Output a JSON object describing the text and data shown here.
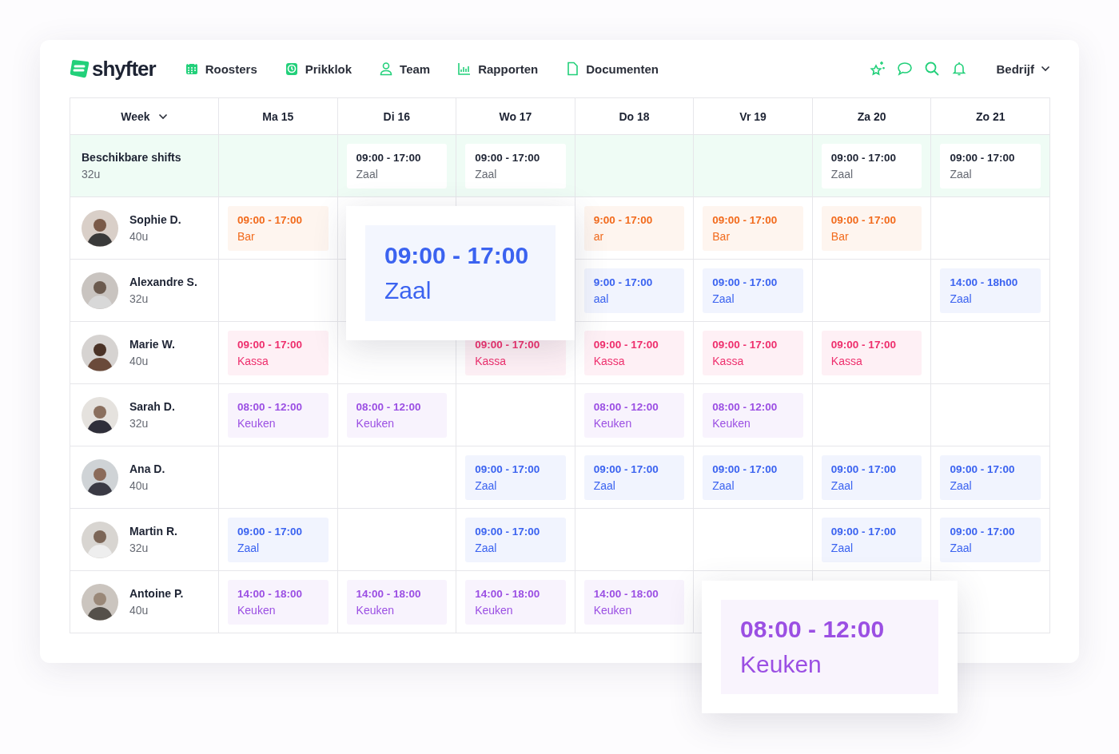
{
  "nav": {
    "logo": "shyfter",
    "items": [
      {
        "label": "Roosters"
      },
      {
        "label": "Prikklok"
      },
      {
        "label": "Team"
      },
      {
        "label": "Rapporten"
      },
      {
        "label": "Documenten"
      }
    ],
    "company": "Bedrijf"
  },
  "table": {
    "week_label": "Week",
    "days": [
      "Ma 15",
      "Di 16",
      "Wo 17",
      "Do 18",
      "Vr 19",
      "Za 20",
      "Zo 21"
    ],
    "available": {
      "title": "Beschikbare shifts",
      "hours": "32u",
      "shifts": [
        {
          "kind": "empty"
        },
        {
          "kind": "shift",
          "time": "09:00 - 17:00",
          "label": "Zaal"
        },
        {
          "kind": "shift",
          "time": "09:00 - 17:00",
          "label": "Zaal"
        },
        {
          "kind": "empty"
        },
        {
          "kind": "empty"
        },
        {
          "kind": "shift",
          "time": "09:00 - 17:00",
          "label": "Zaal"
        },
        {
          "kind": "shift",
          "time": "09:00 - 17:00",
          "label": "Zaal"
        }
      ]
    },
    "rows": [
      {
        "name": "Sophie D.",
        "hours": "40u",
        "shifts": [
          {
            "kind": "shift",
            "time": "09:00 - 17:00",
            "label": "Bar",
            "color": "#f26b1d"
          },
          {
            "kind": "empty"
          },
          {
            "kind": "empty"
          },
          {
            "kind": "shift",
            "time": "9:00 - 17:00",
            "label": "ar",
            "color": "#f26b1d"
          },
          {
            "kind": "shift",
            "time": "09:00 - 17:00",
            "label": "Bar",
            "color": "#f26b1d"
          },
          {
            "kind": "shift",
            "time": "09:00 - 17:00",
            "label": "Bar",
            "color": "#f26b1d"
          },
          {
            "kind": "empty"
          }
        ]
      },
      {
        "name": "Alexandre S.",
        "hours": "32u",
        "shifts": [
          {
            "kind": "empty"
          },
          {
            "kind": "empty"
          },
          {
            "kind": "empty"
          },
          {
            "kind": "shift",
            "time": "9:00 - 17:00",
            "label": "aal",
            "color": "#3b63f0"
          },
          {
            "kind": "shift",
            "time": "09:00 - 17:00",
            "label": "Zaal",
            "color": "#3b63f0"
          },
          {
            "kind": "empty"
          },
          {
            "kind": "shift",
            "time": "14:00 - 18h00",
            "label": "Zaal",
            "color": "#3b63f0"
          }
        ]
      },
      {
        "name": "Marie W.",
        "hours": "40u",
        "shifts": [
          {
            "kind": "shift",
            "time": "09:00 - 17:00",
            "label": "Kassa",
            "color": "#ee2f6d"
          },
          {
            "kind": "empty"
          },
          {
            "kind": "shift",
            "time": "09:00 - 17:00",
            "label": "Kassa",
            "color": "#ee2f6d"
          },
          {
            "kind": "shift",
            "time": "09:00 - 17:00",
            "label": "Kassa",
            "color": "#ee2f6d"
          },
          {
            "kind": "shift",
            "time": "09:00 - 17:00",
            "label": "Kassa",
            "color": "#ee2f6d"
          },
          {
            "kind": "shift",
            "time": "09:00 - 17:00",
            "label": "Kassa",
            "color": "#ee2f6d"
          },
          {
            "kind": "empty"
          }
        ]
      },
      {
        "name": "Sarah D.",
        "hours": "32u",
        "shifts": [
          {
            "kind": "shift",
            "time": "08:00 - 12:00",
            "label": "Keuken",
            "color": "#9b4fe3"
          },
          {
            "kind": "shift",
            "time": "08:00 - 12:00",
            "label": "Keuken",
            "color": "#9b4fe3"
          },
          {
            "kind": "empty"
          },
          {
            "kind": "shift",
            "time": "08:00 - 12:00",
            "label": "Keuken",
            "color": "#9b4fe3"
          },
          {
            "kind": "shift",
            "time": "08:00 - 12:00",
            "label": "Keuken",
            "color": "#9b4fe3"
          },
          {
            "kind": "empty"
          },
          {
            "kind": "empty"
          }
        ]
      },
      {
        "name": "Ana D.",
        "hours": "40u",
        "shifts": [
          {
            "kind": "empty"
          },
          {
            "kind": "empty"
          },
          {
            "kind": "shift",
            "time": "09:00 - 17:00",
            "label": "Zaal",
            "color": "#3b63f0"
          },
          {
            "kind": "shift",
            "time": "09:00 - 17:00",
            "label": "Zaal",
            "color": "#3b63f0"
          },
          {
            "kind": "shift",
            "time": "09:00 - 17:00",
            "label": "Zaal",
            "color": "#3b63f0"
          },
          {
            "kind": "shift",
            "time": "09:00 - 17:00",
            "label": "Zaal",
            "color": "#3b63f0"
          },
          {
            "kind": "shift",
            "time": "09:00 - 17:00",
            "label": "Zaal",
            "color": "#3b63f0"
          }
        ]
      },
      {
        "name": "Martin R.",
        "hours": "32u",
        "shifts": [
          {
            "kind": "shift",
            "time": "09:00 - 17:00",
            "label": "Zaal",
            "color": "#3b63f0"
          },
          {
            "kind": "empty"
          },
          {
            "kind": "shift",
            "time": "09:00 - 17:00",
            "label": "Zaal",
            "color": "#3b63f0"
          },
          {
            "kind": "empty"
          },
          {
            "kind": "empty"
          },
          {
            "kind": "shift",
            "time": "09:00 - 17:00",
            "label": "Zaal",
            "color": "#3b63f0"
          },
          {
            "kind": "shift",
            "time": "09:00 - 17:00",
            "label": "Zaal",
            "color": "#3b63f0"
          }
        ]
      },
      {
        "name": "Antoine P.",
        "hours": "40u",
        "shifts": [
          {
            "kind": "shift",
            "time": "14:00 - 18:00",
            "label": "Keuken",
            "color": "#9b4fe3"
          },
          {
            "kind": "shift",
            "time": "14:00 - 18:00",
            "label": "Keuken",
            "color": "#9b4fe3"
          },
          {
            "kind": "shift",
            "time": "14:00 - 18:00",
            "label": "Keuken",
            "color": "#9b4fe3"
          },
          {
            "kind": "shift",
            "time": "14:00 - 18:00",
            "label": "Keuken",
            "color": "#9b4fe3"
          },
          {
            "kind": "empty"
          },
          {
            "kind": "empty"
          },
          {
            "kind": "empty"
          }
        ]
      }
    ]
  },
  "popups": [
    {
      "time": "09:00 - 17:00",
      "label": "Zaal",
      "color": "#3b63f0"
    },
    {
      "time": "08:00 - 12:00",
      "label": "Keuken",
      "color": "#9b4fe3"
    }
  ]
}
